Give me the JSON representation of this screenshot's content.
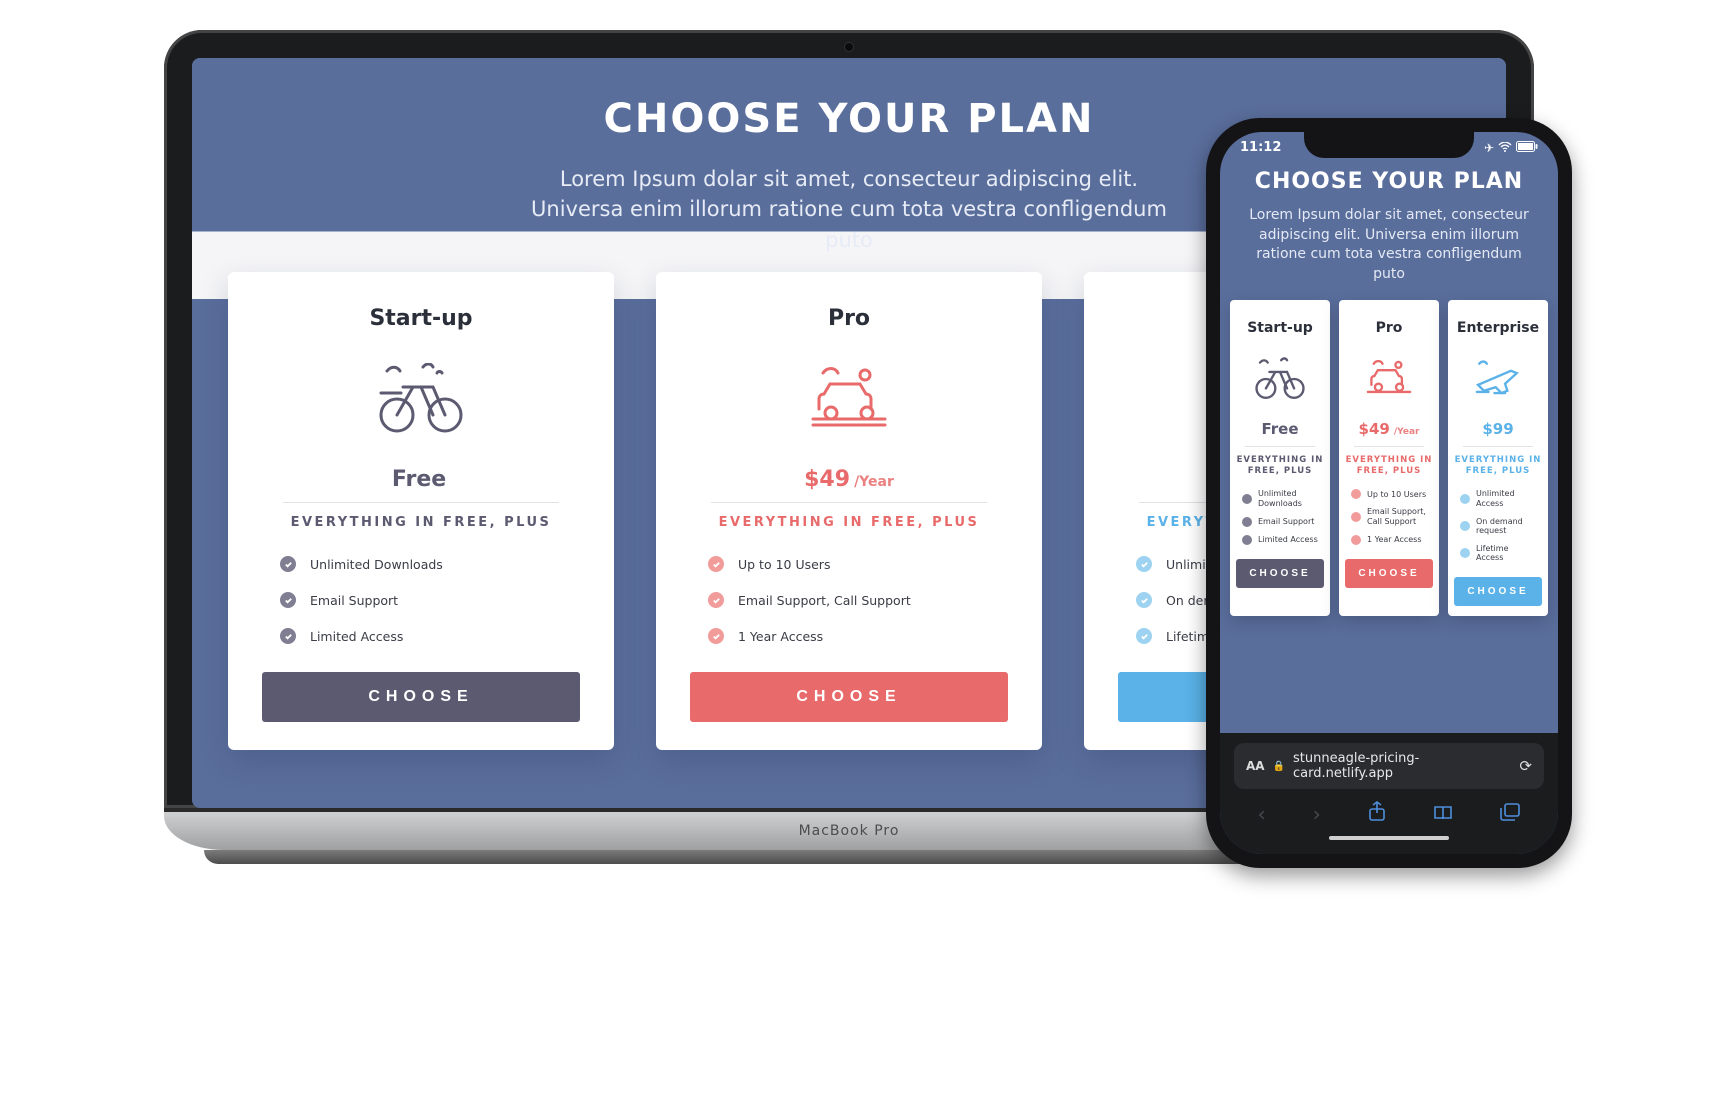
{
  "laptop_label": "MacBook Pro",
  "page": {
    "title": "CHOOSE YOUR PLAN",
    "subtitle": "Lorem Ipsum dolar sit amet, consecteur adipiscing elit. Universa enim illorum ratione cum tota vestra confligendum puto"
  },
  "cta_label": "CHOOSE",
  "features_heading": "EVERYTHING IN FREE, PLUS",
  "plans": [
    {
      "id": "start-up",
      "name": "Start-up",
      "icon": "bicycle-icon",
      "color": "purple",
      "accent": "#5b5a70",
      "price": "Free",
      "period": "",
      "features": [
        "Unlimited Downloads",
        "Email Support",
        "Limited Access"
      ]
    },
    {
      "id": "pro",
      "name": "Pro",
      "icon": "car-icon",
      "color": "coral",
      "accent": "#e86a6a",
      "price": "$49",
      "period": "/Year",
      "features": [
        "Up to 10 Users",
        "Email Support, Call Support",
        "1 Year Access"
      ]
    },
    {
      "id": "enterprise",
      "name": "Enterprise",
      "icon": "plane-icon",
      "color": "blue",
      "accent": "#5ab2e8",
      "price": "$99",
      "period": "",
      "features": [
        "Unlimited Access",
        "On demand request",
        "Lifetime Access"
      ]
    }
  ],
  "phone": {
    "time": "11:12",
    "url_text": "stunneagle-pricing-card.netlify.app",
    "aa": "AA"
  }
}
